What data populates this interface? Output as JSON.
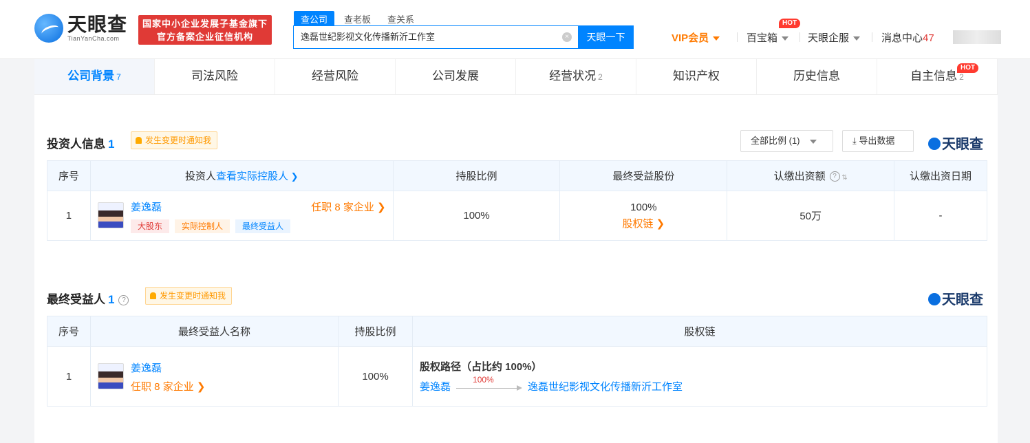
{
  "header": {
    "logo_cn": "天眼查",
    "logo_en": "TianYanCha.com",
    "badge_line1": "国家中小企业发展子基金旗下",
    "badge_line2": "官方备案企业征信机构",
    "search_tabs": [
      "查公司",
      "查老板",
      "查关系"
    ],
    "search_value": "逸磊世纪影视文化传播新沂工作室",
    "search_button": "天眼一下",
    "vip": "VIP会员",
    "baibaoxiang": "百宝箱",
    "qifu": "天眼企服",
    "msg_center": "消息中心",
    "msg_count": "47",
    "hot": "HOT"
  },
  "tabs": [
    {
      "label": "公司背景",
      "count": "7"
    },
    {
      "label": "司法风险",
      "count": ""
    },
    {
      "label": "经营风险",
      "count": ""
    },
    {
      "label": "公司发展",
      "count": ""
    },
    {
      "label": "经营状况",
      "count": "2"
    },
    {
      "label": "知识产权",
      "count": ""
    },
    {
      "label": "历史信息",
      "count": ""
    },
    {
      "label": "自主信息",
      "count": "2"
    }
  ],
  "investors": {
    "title": "投资人信息",
    "count": "1",
    "notify": "发生变更时通知我",
    "ratio_btn": "全部比例 (1)",
    "export_btn": "导出数据",
    "brand": "天眼查",
    "headers": {
      "no": "序号",
      "investor": "投资人",
      "view_controller": "查看实际控股人",
      "ratio": "持股比例",
      "final_share": "最终受益股份",
      "capital": "认缴出资额",
      "date": "认缴出资日期"
    },
    "row": {
      "no": "1",
      "name": "姜逸磊",
      "positions": "任职 8 家企业",
      "tags": [
        "大股东",
        "实际控制人",
        "最终受益人"
      ],
      "ratio": "100%",
      "final_share": "100%",
      "chain": "股权链",
      "capital": "50万",
      "date": "-"
    }
  },
  "beneficiary": {
    "title": "最终受益人",
    "count": "1",
    "notify": "发生变更时通知我",
    "brand": "天眼查",
    "headers": {
      "no": "序号",
      "name": "最终受益人名称",
      "ratio": "持股比例",
      "chain": "股权链"
    },
    "row": {
      "no": "1",
      "name": "姜逸磊",
      "positions": "任职 8 家企业",
      "ratio": "100%",
      "path_title": "股权路径（占比约 100%）",
      "path_from": "姜逸磊",
      "path_pct": "100%",
      "path_to": "逸磊世纪影视文化传播新沂工作室"
    }
  }
}
